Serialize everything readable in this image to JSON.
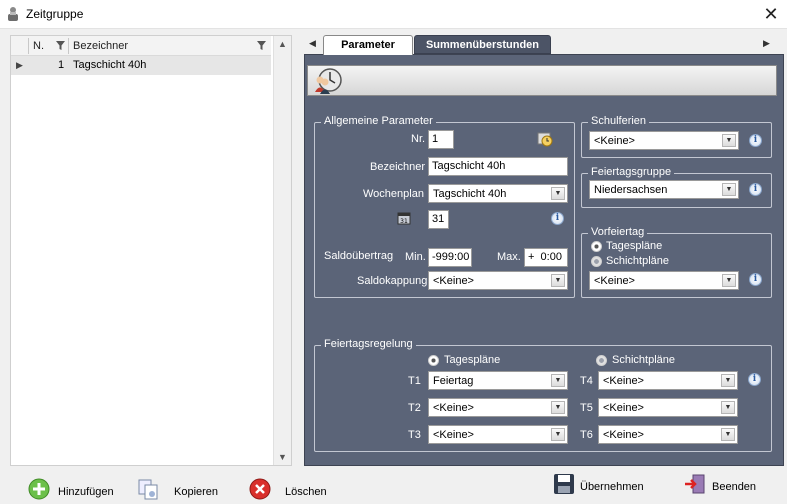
{
  "window": {
    "title": "Zeitgruppe",
    "close_glyph": "✕"
  },
  "grid": {
    "columns": [
      "N.",
      "Bezeichner"
    ],
    "rows": [
      {
        "nr": "1",
        "bezeichner": "Tagschicht 40h"
      }
    ]
  },
  "tabs": [
    {
      "label": "Parameter",
      "active": true
    },
    {
      "label": "Summenüberstunden",
      "active": false
    }
  ],
  "allgemeine": {
    "title": "Allgemeine Parameter",
    "nr_label": "Nr.",
    "nr_value": "1",
    "bezeichner_label": "Bezeichner",
    "bezeichner_value": "Tagschicht 40h",
    "wochenplan_label": "Wochenplan",
    "wochenplan_value": "Tagschicht 40h",
    "days_value": "31",
    "saldo_label": "Saldoübertrag",
    "min_label": "Min.",
    "min_value": "-999:00",
    "max_label": "Max.",
    "max_value": "+  0:00",
    "kappung_label": "Saldokappung",
    "kappung_value": "<Keine>"
  },
  "schulferien": {
    "title": "Schulferien",
    "value": "<Keine>"
  },
  "feiertagsgruppe": {
    "title": "Feiertagsgruppe",
    "value": "Niedersachsen"
  },
  "vorfeiertag": {
    "title": "Vorfeiertag",
    "option1": "Tagespläne",
    "option2": "Schichtpläne",
    "value": "<Keine>"
  },
  "feiertagsregelung": {
    "title": "Feiertagsregelung",
    "option1": "Tagespläne",
    "option2": "Schichtpläne",
    "left": [
      {
        "label": "T1",
        "value": "Feiertag"
      },
      {
        "label": "T2",
        "value": "<Keine>"
      },
      {
        "label": "T3",
        "value": "<Keine>"
      }
    ],
    "right": [
      {
        "label": "T4",
        "value": "<Keine>"
      },
      {
        "label": "T5",
        "value": "<Keine>"
      },
      {
        "label": "T6",
        "value": "<Keine>"
      }
    ]
  },
  "buttons": {
    "add": "Hinzufügen",
    "copy": "Kopieren",
    "delete": "Löschen",
    "save": "Übernehmen",
    "exit": "Beenden"
  },
  "icons": {
    "info": "i",
    "combo_arrow": "▼",
    "scroll_up": "▲",
    "scroll_down": "▼",
    "tab_left": "◀",
    "tab_right": "▶",
    "row_pointer": "▶",
    "filter": "filter-icon"
  },
  "colors": {
    "panel": "#5b6478",
    "accent": "#2a5aa0"
  }
}
